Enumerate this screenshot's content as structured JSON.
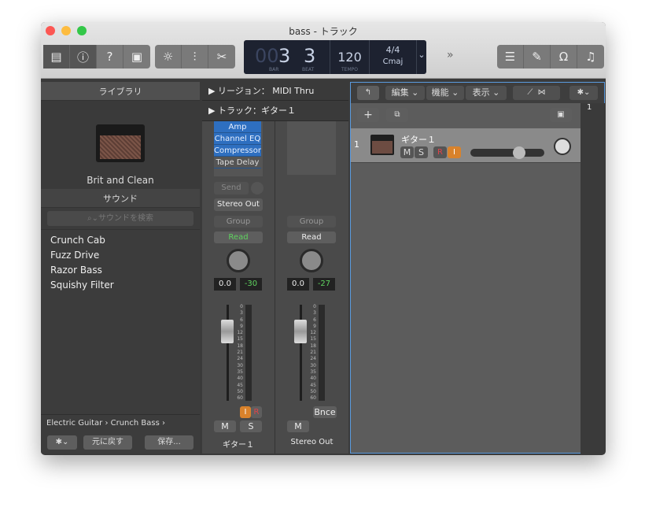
{
  "window": {
    "title": "bass - トラック"
  },
  "toolbar": {
    "left_icons": [
      "library-icon",
      "info-icon",
      "help-icon",
      "editor-icon"
    ],
    "mid_icons": [
      "metronome-icon",
      "mixer-icon",
      "scissors-icon"
    ],
    "right_icons": [
      "list-icon",
      "notepad-icon",
      "loop-icon",
      "media-icon"
    ],
    "more": "»"
  },
  "lcd": {
    "bar_dim": "00",
    "bar": "3",
    "beat": "3",
    "bar_label": "BAR",
    "beat_label": "BEAT",
    "tempo": "120",
    "tempo_label": "TEMPO",
    "signature": "4/4",
    "key": "Cmaj",
    "dropdown": "⌄"
  },
  "library": {
    "header": "ライブラリ",
    "patch_name": "Brit and Clean",
    "sound_header": "サウンド",
    "search_placeholder": "サウンドを検索",
    "items": [
      "Crunch Cab",
      "Fuzz Drive",
      "Razor Bass",
      "Squishy Filter"
    ],
    "path": [
      "Electric Guitar",
      "Crunch Bass"
    ],
    "revert": "元に戻す",
    "save": "保存..."
  },
  "inspector": {
    "region": "▶ リージョン： MIDI Thru",
    "track": "▶ トラック：ギター１",
    "plugins": [
      "Amp",
      "Channel EQ",
      "Compressor",
      "Tape Delay"
    ],
    "send": "Send",
    "output": "Stereo Out",
    "group": "Group",
    "read": "Read",
    "meter_scale": [
      "0",
      "3",
      "6",
      "9",
      "12",
      "15",
      "18",
      "21",
      "24",
      "30",
      "35",
      "40",
      "45",
      "50",
      "60"
    ],
    "strips": [
      {
        "name": "ギター１",
        "volume": "0.0",
        "peak": "-30",
        "input": "I",
        "record": "R",
        "mute": "M",
        "solo": "S"
      },
      {
        "name": "Stereo Out",
        "volume": "0.0",
        "peak": "-27",
        "bounce": "Bnce",
        "mute": "M"
      }
    ]
  },
  "tracks": {
    "menu": [
      "編集",
      "機能",
      "表示"
    ],
    "ruler_bar": "1",
    "list": [
      {
        "number": "1",
        "name": "ギター１",
        "mute": "M",
        "solo": "S",
        "record": "R",
        "input": "I",
        "volume_fraction": 0.7
      }
    ]
  },
  "colors": {
    "accent": "#2e6fc0",
    "green": "#5fd35f",
    "orange": "#d9822b",
    "red": "#e0434a"
  }
}
